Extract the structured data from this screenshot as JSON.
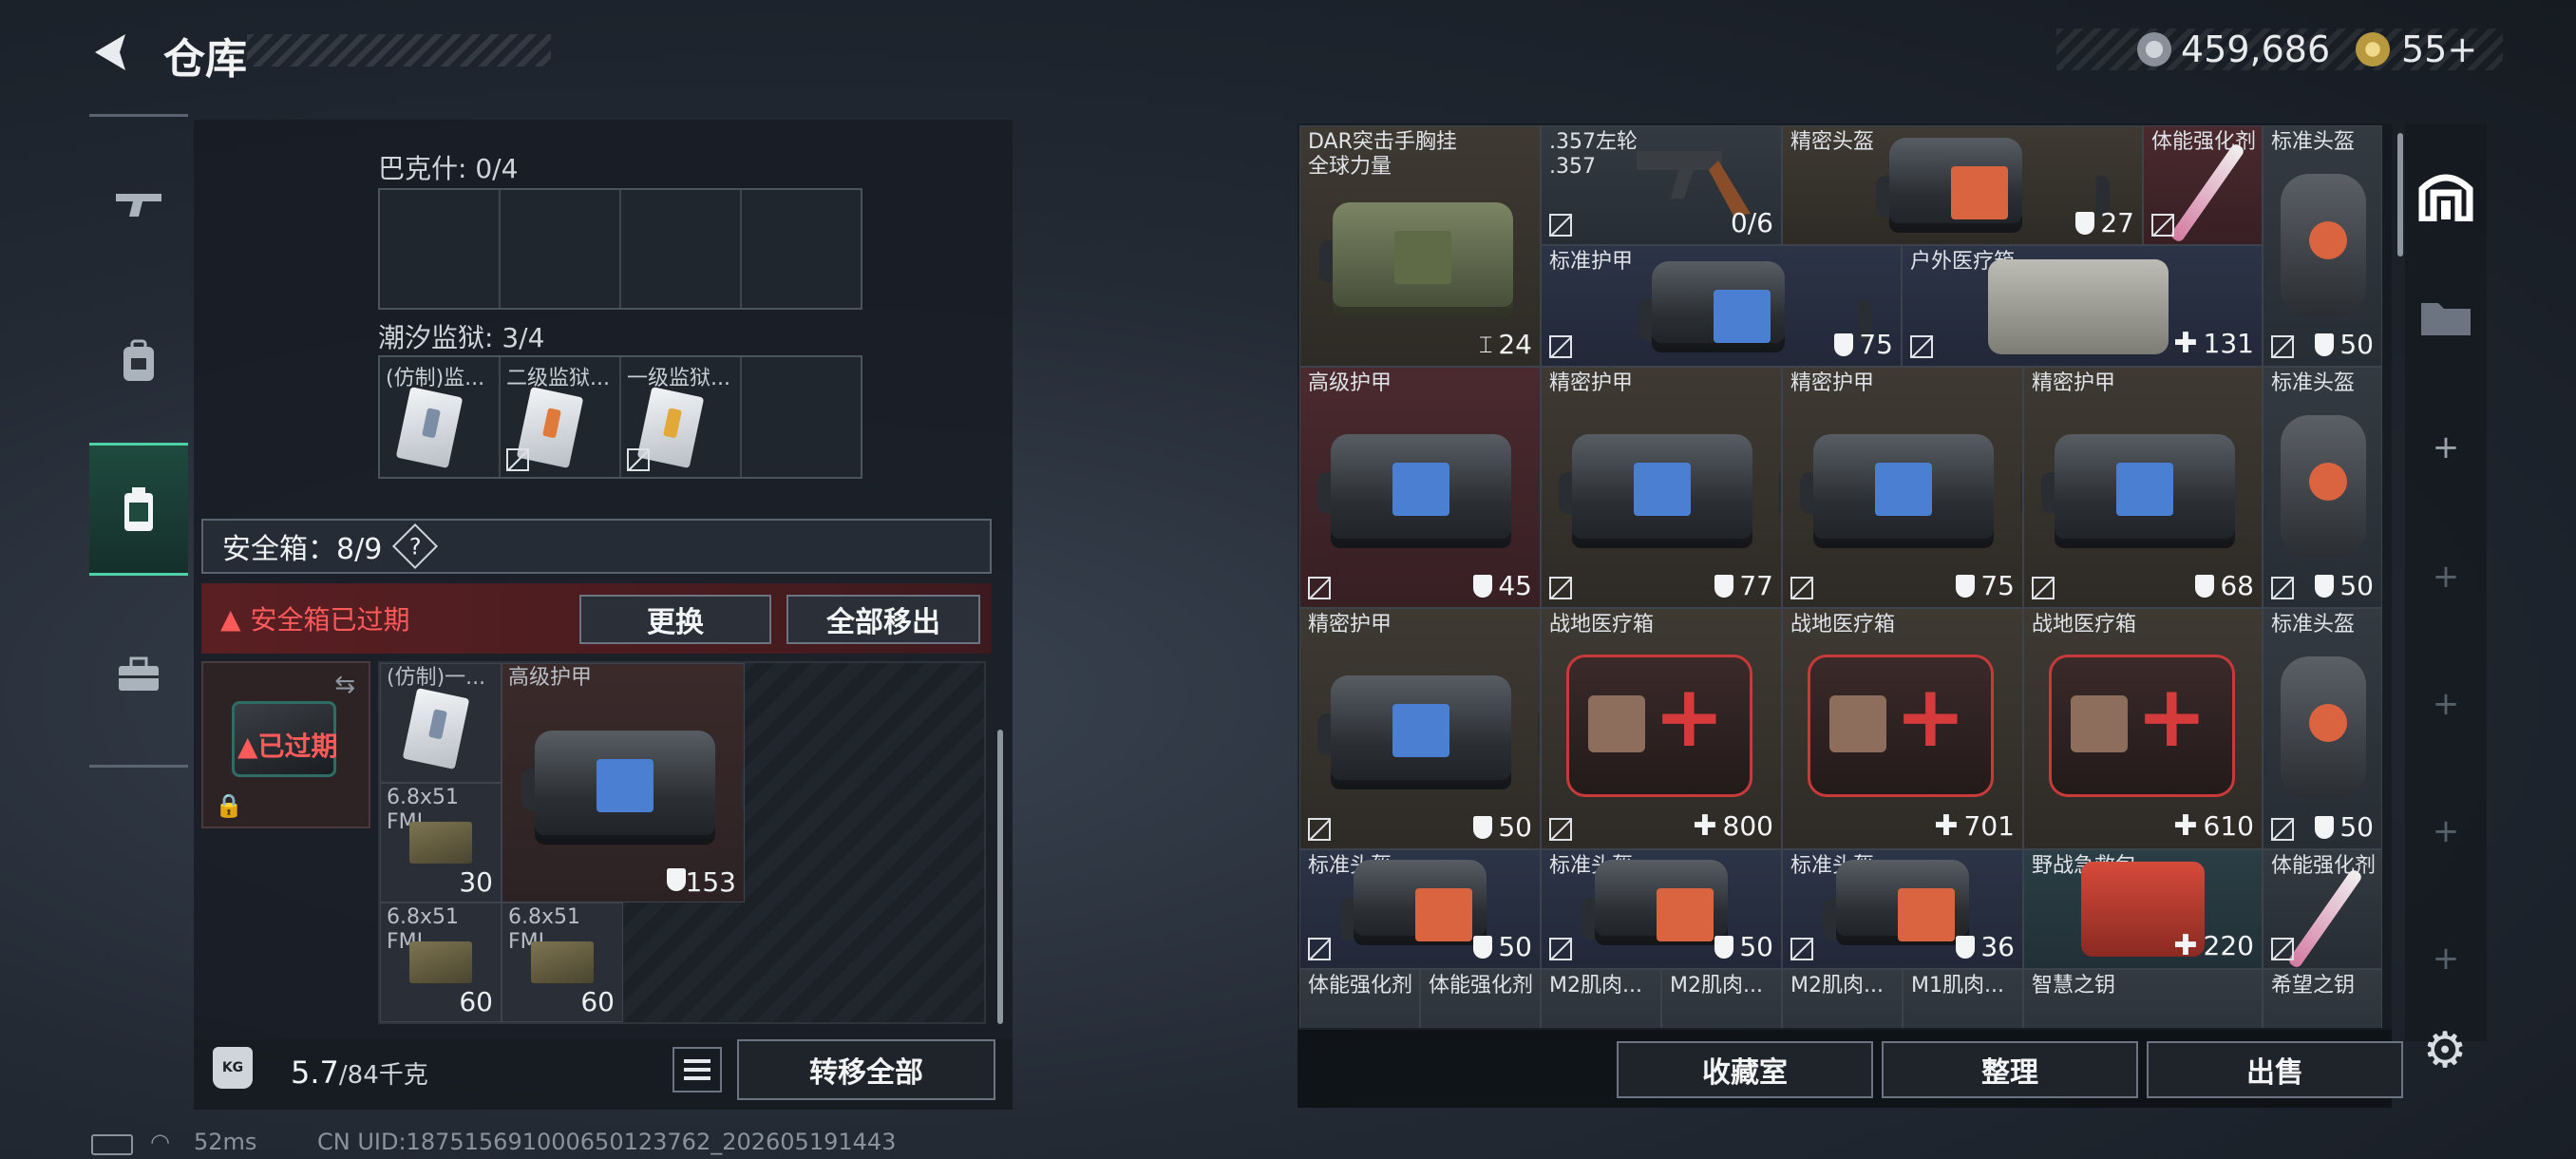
{
  "header": {
    "title": "仓库"
  },
  "currency": {
    "silver": "459,686",
    "gold": "55+"
  },
  "left_rail": {
    "tabs": [
      "gun-icon",
      "backpack-icon",
      "safebox-icon",
      "toolbox-icon"
    ]
  },
  "left_panel": {
    "bakeshi_label": "巴克什: 0/4",
    "chaoxi_label": "潮汐监狱: 3/4",
    "chaoxi_items": [
      "(仿制)监...",
      "二级监狱...",
      "一级监狱..."
    ],
    "safebox_label": "安全箱：8/9",
    "safebox_help": "?",
    "expired_warning": "安全箱已过期",
    "replace_btn": "更换",
    "remove_all_btn": "全部移出",
    "case_expired": "已过期",
    "grid_items": [
      {
        "name": "(仿制)一...",
        "value": ""
      },
      {
        "name": "高级护甲",
        "value": "153"
      },
      {
        "name": "6.8x51\nFMJ",
        "value": "30"
      },
      {
        "name": "6.8x51\nFMJ",
        "value": "60"
      },
      {
        "name": "6.8x51\nFMJ",
        "value": "60"
      }
    ],
    "weight_value": "5.7",
    "weight_unit": "/84千克",
    "kg_icon_label": "KG",
    "transfer_all": "转移全部"
  },
  "status": {
    "ping": "52ms",
    "uid": "CN UID:18751569100065012376​2_202605191443"
  },
  "items": [
    {
      "name": "DAR突击手胸挂\n全球力量",
      "value": "24"
    },
    {
      "name": ".357左轮\n.357",
      "value": "0/6"
    },
    {
      "name": "精密头盔",
      "value": "27"
    },
    {
      "name": "体能强化剂",
      "value": ""
    },
    {
      "name": "标准头盔",
      "value": "50"
    },
    {
      "name": "标准护甲",
      "value": "75"
    },
    {
      "name": "户外医疗箱",
      "value": "131"
    },
    {
      "name": "高级护甲",
      "value": "45"
    },
    {
      "name": "精密护甲",
      "value": "77"
    },
    {
      "name": "精密护甲",
      "value": "75"
    },
    {
      "name": "精密护甲",
      "value": "68"
    },
    {
      "name": "标准头盔",
      "value": "50"
    },
    {
      "name": "精密护甲",
      "value": "50"
    },
    {
      "name": "战地医疗箱",
      "value": "800"
    },
    {
      "name": "战地医疗箱",
      "value": "701"
    },
    {
      "name": "战地医疗箱",
      "value": "610"
    },
    {
      "name": "标准头盔",
      "value": "50"
    },
    {
      "name": "标准头盔",
      "value": "50"
    },
    {
      "name": "标准头盔",
      "value": "50"
    },
    {
      "name": "标准头盔",
      "value": "36"
    },
    {
      "name": "野战急救包",
      "value": "220"
    },
    {
      "name": "体能强化剂",
      "value": ""
    },
    {
      "name": "体能强化剂",
      "value": ""
    },
    {
      "name": "体能强化剂",
      "value": ""
    },
    {
      "name": "M2肌肉...",
      "value": ""
    },
    {
      "name": "M2肌肉...",
      "value": ""
    },
    {
      "name": "M2肌肉...",
      "value": ""
    },
    {
      "name": "M1肌肉...",
      "value": ""
    },
    {
      "name": "智慧之钥",
      "value": ""
    },
    {
      "name": "希望之钥",
      "value": ""
    }
  ],
  "bottom": {
    "collection": "收藏室",
    "sort": "整理",
    "sell": "出售"
  },
  "colors": {
    "accent": "#4fd1a6",
    "warning": "#ff5a5a"
  }
}
